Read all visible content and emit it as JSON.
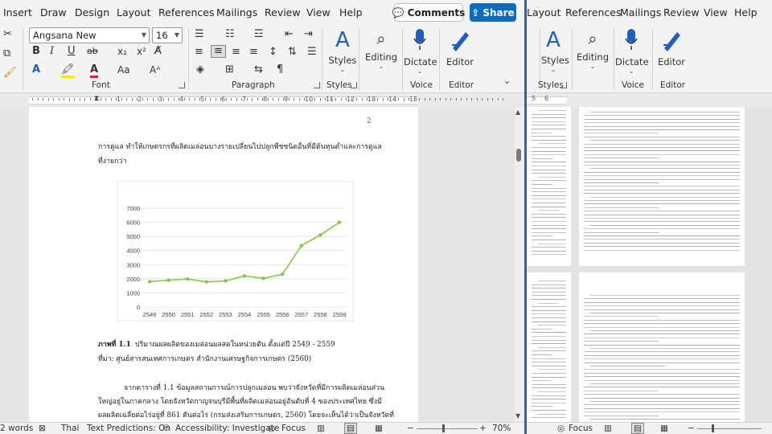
{
  "left": {
    "tabs": [
      "Insert",
      "Draw",
      "Design",
      "Layout",
      "References",
      "Mailings",
      "Review",
      "View",
      "Help"
    ],
    "comments_label": "Comments",
    "share_label": "Share",
    "font": {
      "name": "Angsana New",
      "size": "16"
    },
    "groups": {
      "font": "Font",
      "paragraph": "Paragraph",
      "styles": "Styles",
      "voice": "Voice",
      "editor": "Editor"
    },
    "big_buttons": {
      "styles": "Styles",
      "editing": "Editing",
      "dictate": "Dictate",
      "editor": "Editor"
    },
    "format_buttons": {
      "bold": "B",
      "italic": "I",
      "underline": "U",
      "strike": "ab",
      "subscript": "x₂",
      "superscript": "x²",
      "change_case": "Aa",
      "font_color_letter": "A"
    }
  },
  "ruler": {
    "left_numbers": [
      "1",
      "2",
      "3",
      "4",
      "5",
      "6",
      "7",
      "8",
      "9",
      "10",
      "11",
      "12",
      "13",
      "14",
      "15"
    ],
    "right_numbers": [
      "5",
      "6"
    ]
  },
  "document": {
    "page_number": "2",
    "para1_line1": "การดูแล ทำให้เกษตรกรที่ผลิตเมล่อนบางรายเปลี่ยนไปปลูกพืชชนิดอื่นที่มีต้นทุนต่ำและการดูแล",
    "para1_line2": "ที่ง่ายกว่า",
    "caption_label": "ภาพที่ 1.1",
    "caption_text": " ปริมาณผลผลิตของเมล่อนผลสดในหน่วยตัน ตั้งแต่ปี 2549 - 2559",
    "source": "ที่มา: ศูนย์สารสนเทศการเกษตร สำนักงานเศรษฐกิจการเกษตร (2560)",
    "para2_line1": "จากตารางที่ 1.1 ข้อมูลสถานการณ์การปลูกเมล่อน พบว่าจังหวัดที่มีการผลิตเมล่อนส่วน",
    "para2_line2": "ใหญ่อยู่ในภาคกลาง โดยจังหวัดกาญจนบุรีมีพื้นที่ผลิตเมล่อนอยู่อันดับที่ 4 ของประเทศไทย ซึ่งมี",
    "para2_line3": "ผลผลิตเฉลี่ยต่อไร่อยู่ที่ 861 ตันต่อไร่ (กรมส่งเสริมการเกษตร, 2560) โดยจะเห็นได้ว่าเป็นจังหวัดที่"
  },
  "chart_data": {
    "type": "line",
    "categories": [
      "2549",
      "2550",
      "2551",
      "2552",
      "2553",
      "2554",
      "2555",
      "2556",
      "2557",
      "2558",
      "2559"
    ],
    "values": [
      1800,
      1900,
      1980,
      1780,
      1850,
      2200,
      2030,
      2320,
      4350,
      5100,
      6000
    ],
    "ylim": [
      0,
      7000
    ],
    "yticks": [
      "0",
      "1000",
      "2000",
      "3000",
      "4000",
      "5000",
      "6000",
      "7000"
    ],
    "color": "#8bc34a",
    "grid": true
  },
  "status": {
    "words": "2 words",
    "language": "Thai",
    "predictions": "Text Predictions: On",
    "accessibility": "Accessibility: Investigate",
    "focus": "Focus",
    "zoom": "70%"
  },
  "right": {
    "tabs": [
      "Layout",
      "References",
      "Mailings",
      "Review",
      "View",
      "Help"
    ],
    "big_buttons": {
      "styles": "Styles",
      "editing": "Editing",
      "dictate": "Dictate",
      "editor": "Editor"
    },
    "groups": {
      "styles": "Styles",
      "voice": "Voice",
      "editor": "Editor"
    },
    "status_focus": "Focus"
  }
}
